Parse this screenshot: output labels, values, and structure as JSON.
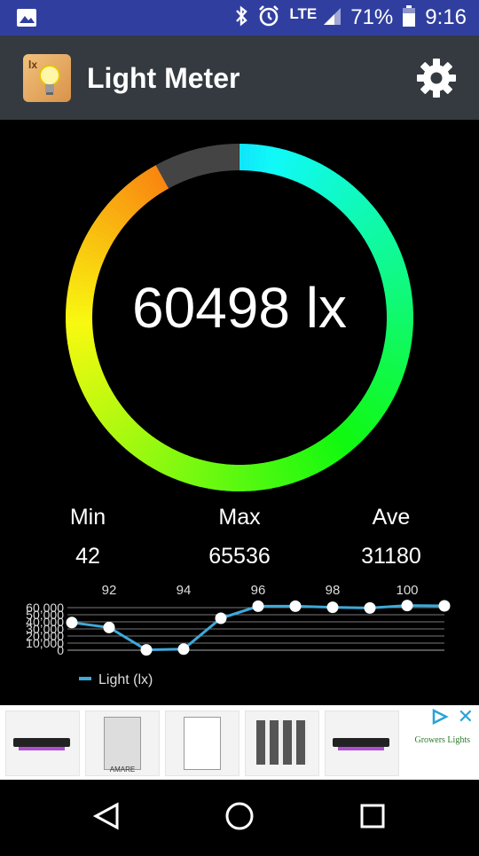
{
  "status_bar": {
    "network": "LTE",
    "battery": "71%",
    "time": "9:16",
    "icons": [
      "image-notification-icon",
      "bluetooth-icon",
      "alarm-icon",
      "signal-icon",
      "battery-icon"
    ],
    "background": "#303F9F"
  },
  "app_bar": {
    "title": "Light Meter",
    "icon_label": "lx",
    "background": "#343a3f"
  },
  "meter": {
    "reading": "60498 lx",
    "fill_fraction": 0.92,
    "track_color": "#444444"
  },
  "stats": {
    "min_label": "Min",
    "max_label": "Max",
    "ave_label": "Ave",
    "min_value": "42",
    "max_value": "65536",
    "ave_value": "31180"
  },
  "chart_data": {
    "type": "line",
    "x_tick_labels": [
      "92",
      "94",
      "96",
      "98",
      "100"
    ],
    "y_tick_labels": [
      "60,000",
      "50,000",
      "40,000",
      "30,000",
      "20,000",
      "10,000",
      "0"
    ],
    "ylim": [
      0,
      60000
    ],
    "series": [
      {
        "name": "Light  (lx)",
        "color": "#3fa9d8",
        "x": [
          91,
          92,
          93,
          94,
          95,
          96,
          97,
          98,
          99,
          100,
          101
        ],
        "values": [
          39000,
          32000,
          500,
          1500,
          45000,
          62000,
          62000,
          60500,
          59500,
          63000,
          62500
        ]
      }
    ],
    "legend": "bottom-left",
    "grid": true
  },
  "ad": {
    "brand_text": "Growers Lights",
    "thumb_labels": [
      "AMARE"
    ],
    "accent": "#29a3d8"
  },
  "nav": {
    "buttons": [
      "back",
      "home",
      "recents"
    ]
  }
}
